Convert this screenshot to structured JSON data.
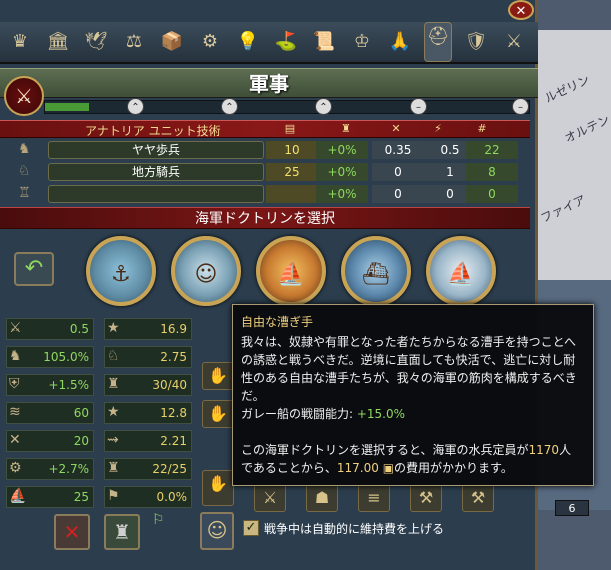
{
  "window": {
    "title": "軍事",
    "close_icon": "close-icon"
  },
  "tabs": [
    {
      "icon": "crown-icon",
      "glyph": "♛"
    },
    {
      "icon": "government-icon",
      "glyph": "🏛"
    },
    {
      "icon": "dove-icon",
      "glyph": "🕊"
    },
    {
      "icon": "economy-icon",
      "glyph": "⚖"
    },
    {
      "icon": "trade-icon",
      "glyph": "📦"
    },
    {
      "icon": "production-icon",
      "glyph": "⚙"
    },
    {
      "icon": "idea-icon",
      "glyph": "💡"
    },
    {
      "icon": "flag-icon",
      "glyph": "⛳"
    },
    {
      "icon": "scroll-icon",
      "glyph": "📜"
    },
    {
      "icon": "estates-icon",
      "glyph": "♔"
    },
    {
      "icon": "religion-icon",
      "glyph": "🙏"
    },
    {
      "icon": "military-icon",
      "glyph": "⛑",
      "active": true
    },
    {
      "icon": "shield-icon",
      "glyph": "🛡"
    },
    {
      "icon": "swords-icon",
      "glyph": "⚔"
    }
  ],
  "tech_progress": {
    "percent": 9,
    "markers": [
      "⌃",
      "⌃",
      "⌃",
      "–",
      "–"
    ]
  },
  "units": {
    "header": "アナトリア ユニット技術",
    "columns": [
      "cost-icon",
      "morale-icon",
      "discipline-icon",
      "speed-icon",
      "#"
    ],
    "column_glyphs": [
      "▤",
      "♜",
      "✕",
      "⚡",
      "#"
    ],
    "rows": [
      {
        "name": "ヤヤ歩兵",
        "sym": "♞",
        "values": [
          "10",
          "+0%",
          "0.35",
          "0.5",
          "22"
        ]
      },
      {
        "name": "地方騎兵",
        "sym": "♘",
        "values": [
          "25",
          "+0%",
          "0",
          "1",
          "8"
        ]
      },
      {
        "name": "",
        "sym": "♖",
        "values": [
          "",
          "+0%",
          "0",
          "0",
          "0"
        ]
      }
    ]
  },
  "doctrine": {
    "header": "海軍ドクトリンを選択",
    "options": [
      {
        "icon": "port-icon",
        "glyph": "⚓"
      },
      {
        "icon": "sailor-icon",
        "glyph": "☺"
      },
      {
        "icon": "harbor-icon",
        "glyph": "⛵"
      },
      {
        "icon": "fleet-icon",
        "glyph": "⛴"
      },
      {
        "icon": "sail-icon",
        "glyph": "⛵"
      }
    ]
  },
  "stats_left": [
    {
      "icon": "infantry-icon",
      "glyph": "⚔",
      "value": "0.5"
    },
    {
      "icon": "horse-icon",
      "glyph": "♞",
      "value": "105.0%"
    },
    {
      "icon": "shield-icon",
      "glyph": "⛨",
      "value": "+1.5%"
    },
    {
      "icon": "cannon-icon",
      "glyph": "≋",
      "value": "60"
    },
    {
      "icon": "crossed-swords-icon",
      "glyph": "✕",
      "value": "20"
    },
    {
      "icon": "artillery-icon",
      "glyph": "⚙",
      "value": "+2.7%"
    },
    {
      "icon": "ship-icon",
      "glyph": "⛵",
      "value": "25"
    }
  ],
  "stats_right": [
    {
      "icon": "general-star-icon",
      "glyph": "★",
      "value": "16.9",
      "yellow": true
    },
    {
      "icon": "cavalry-icon",
      "glyph": "♘",
      "value": "2.75",
      "yellow": true
    },
    {
      "icon": "army-icon",
      "glyph": "♜",
      "value": "30/40",
      "yellow": true
    },
    {
      "icon": "leader-star-icon",
      "glyph": "★",
      "value": "12.8",
      "yellow": true
    },
    {
      "icon": "cannon-range-icon",
      "glyph": "⇝",
      "value": "2.21",
      "yellow": true
    },
    {
      "icon": "regiment-icon",
      "glyph": "♜",
      "value": "22/25",
      "yellow": true
    },
    {
      "icon": "flag-icon",
      "glyph": "⚑",
      "value": "0.0%",
      "yellow": true
    }
  ],
  "tooltip": {
    "title": "自由な漕ぎ手",
    "body": "我々は、奴隷や有罪となった者たちからなる漕手を持つことへの誘惑と戦うべきだ。逆境に直面しても快活で、逃亡に対し耐性のある自由な漕手たちが、我々の海軍の筋肉を構成するべきだ。",
    "galley_label": "ガレー船の戦闘能力: ",
    "galley_value": "+15.0%",
    "cost_line1": "この海軍ドクトリンを選択すると、海軍の水兵定員が",
    "sailors": "1170",
    "cost_line1_end": "人",
    "cost_line2": "であることから、",
    "cost": "117.00",
    "cost_line2_end": "の費用がかかります。"
  },
  "bottom": {
    "auto_maintenance_label": "戦争中は自動的に維持費を上げる",
    "checked": true
  },
  "map": {
    "labels": [
      "ルゼリン",
      "オルテン",
      "ファイア"
    ],
    "badge": "6"
  }
}
